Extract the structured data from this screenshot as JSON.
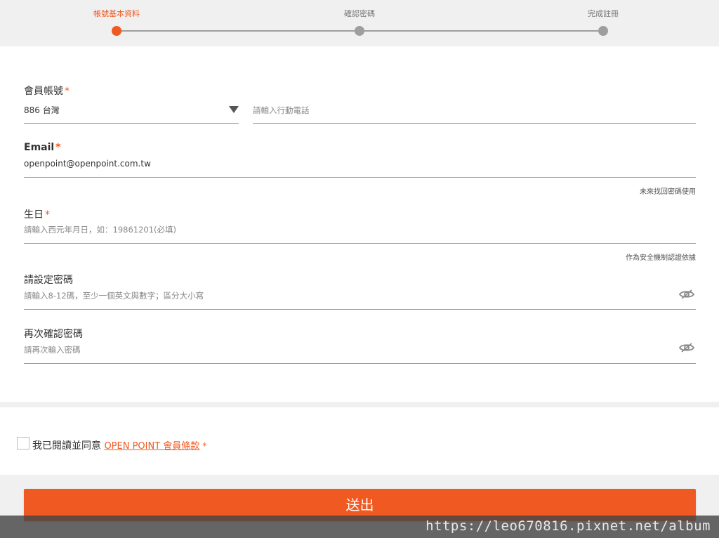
{
  "steps": [
    {
      "label": "帳號基本資料",
      "active": true
    },
    {
      "label": "確認密碼",
      "active": false
    },
    {
      "label": "完成註冊",
      "active": false
    }
  ],
  "account": {
    "label": "會員帳號",
    "required_mark": "*",
    "country": "886 台灣",
    "phone_placeholder": "請輸入行動電話"
  },
  "email": {
    "label": "Email",
    "required_mark": "*",
    "value": "openpoint@openpoint.com.tw",
    "hint": "未來找回密碼使用"
  },
  "birthday": {
    "label": "生日",
    "required_mark": "*",
    "placeholder": "請輸入西元年月日，如：19861201(必填)",
    "hint": "作為安全機制認證依據"
  },
  "password": {
    "label": "請設定密碼",
    "placeholder": "請輸入8-12碼，至少一個英文與數字；區分大小寫"
  },
  "confirm_password": {
    "label": "再次確認密碼",
    "placeholder": "請再次輸入密碼"
  },
  "agreement": {
    "text": "我已閱讀並同意",
    "link": "OPEN POINT 會員條款",
    "required_mark": "*"
  },
  "submit_label": "送出",
  "watermark": "https://leo670816.pixnet.net/album",
  "icons": {
    "dropdown": "caret-down-icon",
    "password_toggle": "eye-slash-icon"
  },
  "colors": {
    "accent": "#f05a22",
    "inactive_step": "#9e9e9e",
    "background": "#f0f0f0"
  }
}
